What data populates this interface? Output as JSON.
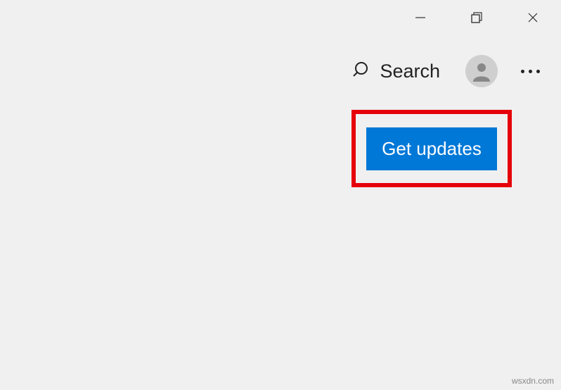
{
  "window_controls": {
    "minimize": "minimize",
    "maximize": "maximize",
    "close": "close"
  },
  "toolbar": {
    "search_label": "Search",
    "more_label": "More options"
  },
  "main": {
    "get_updates_label": "Get updates"
  },
  "watermark": "wsxdn.com",
  "colors": {
    "accent": "#0078d7",
    "highlight": "#e6000a"
  }
}
